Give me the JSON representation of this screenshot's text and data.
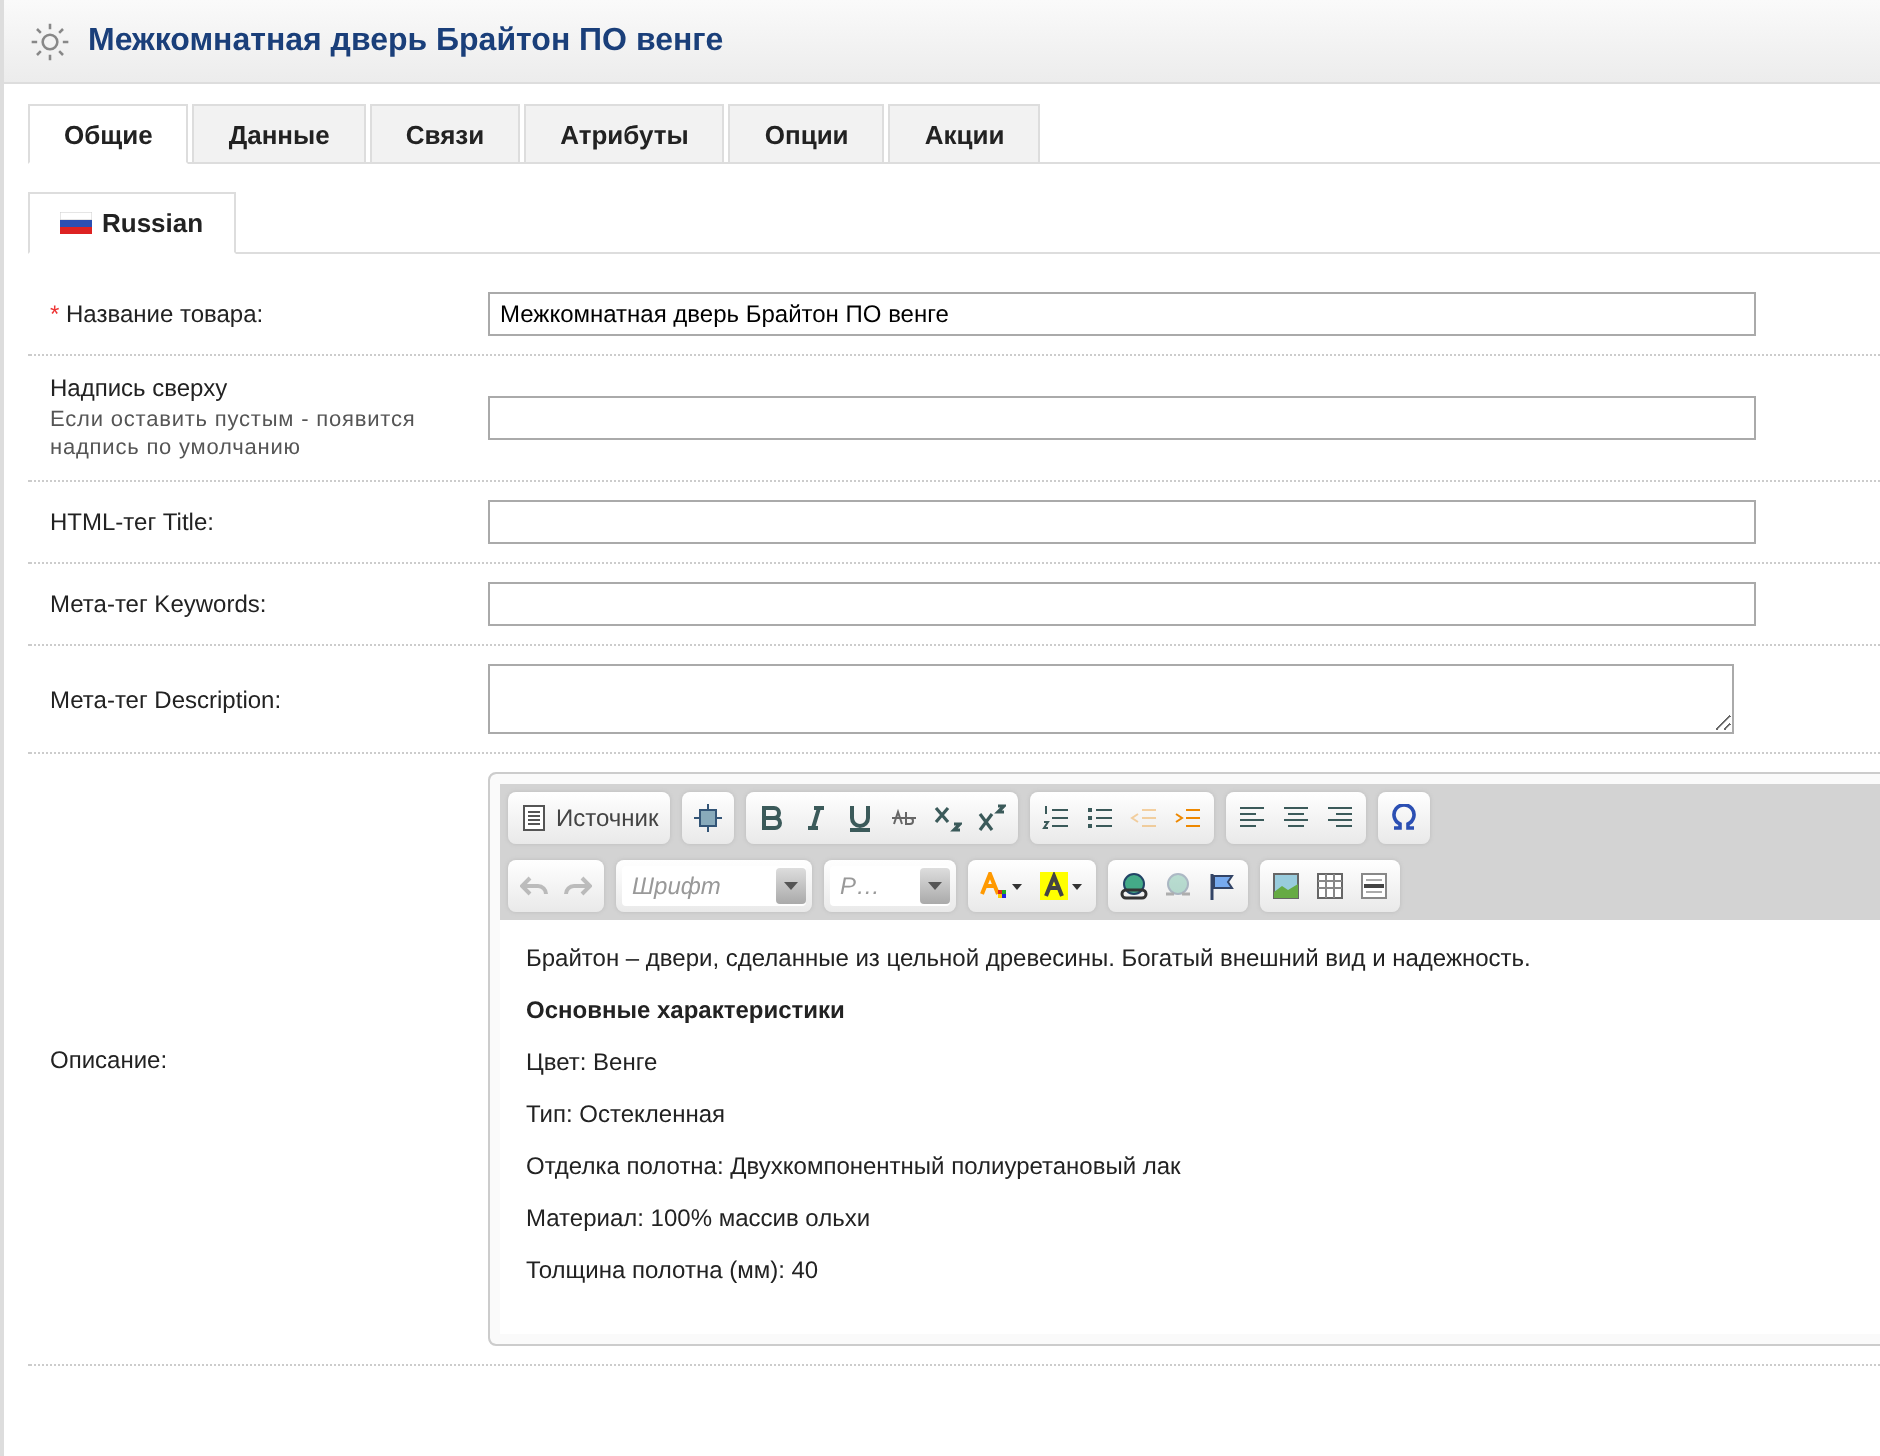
{
  "header": {
    "title": "Межкомнатная дверь Брайтон ПО венге"
  },
  "tabs": [
    {
      "label": "Общие",
      "selected": true
    },
    {
      "label": "Данные",
      "selected": false
    },
    {
      "label": "Связи",
      "selected": false
    },
    {
      "label": "Атрибуты",
      "selected": false
    },
    {
      "label": "Опции",
      "selected": false
    },
    {
      "label": "Акции",
      "selected": false
    }
  ],
  "language_tabs": [
    {
      "label": "Russian",
      "selected": true
    }
  ],
  "fields": [
    {
      "label": "Название товара:",
      "required_mark": "*",
      "kind": "input",
      "value": "Межкомнатная дверь Брайтон ПО венге"
    },
    {
      "label": "Надпись сверху",
      "hint": "Если оставить пустым - появится надпись по умолчанию",
      "kind": "input"
    },
    {
      "label": "HTML-тег Title:",
      "kind": "input"
    },
    {
      "label": "Мета-тег Keywords:",
      "kind": "input"
    },
    {
      "label": "Мета-тег Description:",
      "kind": "textarea"
    }
  ],
  "description": {
    "label": "Описание:",
    "toolbar_rows": [
      [
        [
          {
            "kind": "source",
            "label": "Источник",
            "disabled": false
          }
        ],
        [
          {
            "kind": "maximize",
            "disabled": false
          }
        ],
        [
          {
            "kind": "bold",
            "disabled": false
          },
          {
            "kind": "italic",
            "disabled": false
          },
          {
            "kind": "underline",
            "disabled": false
          },
          {
            "kind": "strike",
            "disabled": false
          },
          {
            "kind": "subscript",
            "disabled": false
          },
          {
            "kind": "superscript",
            "disabled": false
          }
        ],
        [
          {
            "kind": "numbered-list",
            "disabled": false
          },
          {
            "kind": "bulleted-list",
            "disabled": false
          },
          {
            "kind": "outdent",
            "disabled": true
          },
          {
            "kind": "indent",
            "disabled": false
          }
        ],
        [
          {
            "kind": "align-left",
            "disabled": false
          },
          {
            "kind": "align-center",
            "disabled": false
          },
          {
            "kind": "align-right",
            "disabled": false
          }
        ],
        [
          {
            "kind": "omega",
            "disabled": false
          }
        ]
      ],
      [
        [
          {
            "kind": "undo",
            "disabled": true
          },
          {
            "kind": "redo",
            "disabled": true
          }
        ],
        [
          {
            "kind": "combo",
            "placeholder": "Шрифт",
            "disabled": false
          }
        ],
        [
          {
            "kind": "combo",
            "placeholder": "Р…",
            "disabled": false
          }
        ],
        [
          {
            "kind": "text-color",
            "disabled": false
          },
          {
            "kind": "highlight",
            "disabled": false
          }
        ],
        [
          {
            "kind": "link",
            "disabled": false
          },
          {
            "kind": "unlink",
            "disabled": true
          },
          {
            "kind": "anchor",
            "disabled": false
          }
        ],
        [
          {
            "kind": "image",
            "disabled": false
          },
          {
            "kind": "table",
            "disabled": false
          },
          {
            "kind": "hr",
            "disabled": false
          }
        ]
      ]
    ],
    "content": [
      {
        "kind": "text",
        "text": "Брайтон – двери, сделанные из цельной древесины. Богатый внешний вид и надежность."
      },
      {
        "kind": "heading",
        "text": "Основные характеристики"
      },
      {
        "kind": "text",
        "text": "Цвет: Венге"
      },
      {
        "kind": "text",
        "text": "Тип: Остекленная"
      },
      {
        "kind": "text",
        "text": "Отделка полотна: Двухкомпонентный полиуретановый лак"
      },
      {
        "kind": "text",
        "text": "Материал: 100% массив ольхи"
      },
      {
        "kind": "text",
        "text": "Толщина полотна (мм): 40"
      }
    ]
  }
}
